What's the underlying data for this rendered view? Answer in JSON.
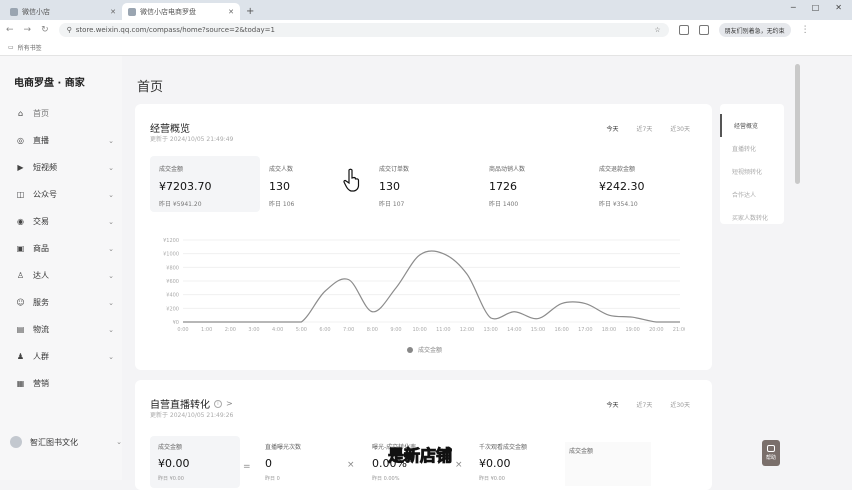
{
  "browser": {
    "tabs": [
      {
        "title": "微信小店"
      },
      {
        "title": "微信小店电商罗盘"
      }
    ],
    "url": "store.weixin.qq.com/compass/home?source=2&today=1",
    "profile": "朋友们别着急，无约束",
    "bookmark": "所有书签"
  },
  "sidebar": {
    "logo": "电商罗盘 · 商家",
    "items": [
      {
        "label": "首页",
        "icon": "home-icon",
        "glyph": "⌂",
        "chev": ""
      },
      {
        "label": "直播",
        "icon": "live-icon",
        "glyph": "◎",
        "chev": "⌄"
      },
      {
        "label": "短视频",
        "icon": "video-icon",
        "glyph": "▶",
        "chev": "⌄"
      },
      {
        "label": "公众号",
        "icon": "official-account-icon",
        "glyph": "◫",
        "chev": "⌄"
      },
      {
        "label": "交易",
        "icon": "trade-icon",
        "glyph": "◉",
        "chev": "⌄"
      },
      {
        "label": "商品",
        "icon": "goods-icon",
        "glyph": "▣",
        "chev": "⌄"
      },
      {
        "label": "达人",
        "icon": "talent-icon",
        "glyph": "♙",
        "chev": "⌄"
      },
      {
        "label": "服务",
        "icon": "service-icon",
        "glyph": "☺",
        "chev": "⌄"
      },
      {
        "label": "物流",
        "icon": "logistics-icon",
        "glyph": "▤",
        "chev": "⌄"
      },
      {
        "label": "人群",
        "icon": "crowd-icon",
        "glyph": "♟",
        "chev": "⌄"
      },
      {
        "label": "营销",
        "icon": "marketing-icon",
        "glyph": "▦",
        "chev": ""
      }
    ],
    "shop_name": "智汇图书文化"
  },
  "page_title": "首页",
  "overview": {
    "title": "经营概览",
    "updated": "更新于 2024/10/05 21:49:49",
    "ranges": [
      "今天",
      "近7天",
      "近30天"
    ],
    "kpis": [
      {
        "label": "成交金额",
        "value": "¥7203.70",
        "prev": "昨日 ¥5941.20"
      },
      {
        "label": "成交人数",
        "value": "130",
        "prev": "昨日 106"
      },
      {
        "label": "成交订单数",
        "value": "130",
        "prev": "昨日 107"
      },
      {
        "label": "商品动销人数",
        "value": "1726",
        "prev": "昨日 1400"
      },
      {
        "label": "成交退款金额",
        "value": "¥242.30",
        "prev": "昨日 ¥354.10"
      }
    ],
    "legend": "成交金额"
  },
  "chart_data": {
    "type": "line",
    "x": [
      "0:00",
      "1:00",
      "2:00",
      "3:00",
      "4:00",
      "5:00",
      "6:00",
      "7:00",
      "8:00",
      "9:00",
      "10:00",
      "11:00",
      "12:00",
      "13:00",
      "14:00",
      "15:00",
      "16:00",
      "17:00",
      "18:00",
      "19:00",
      "20:00",
      "21:00"
    ],
    "y_ticks": [
      "¥0",
      "¥200",
      "¥400",
      "¥600",
      "¥800",
      "¥1000",
      "¥1200"
    ],
    "ylim": [
      0,
      1200
    ],
    "series": [
      {
        "name": "成交金额",
        "values": [
          0,
          0,
          0,
          0,
          0,
          0,
          450,
          620,
          150,
          500,
          980,
          1000,
          700,
          60,
          150,
          50,
          270,
          270,
          100,
          70,
          0,
          0
        ]
      }
    ]
  },
  "subnav": [
    "经营概览",
    "直播转化",
    "短视频转化",
    "合作达人",
    "买家人数转化"
  ],
  "live": {
    "title": "自营直播转化",
    "info": "i",
    "arrow": ">",
    "updated": "更新于 2024/10/05 21:49:26",
    "ranges": [
      "今天",
      "近7天",
      "近30天"
    ],
    "kpis": [
      {
        "label": "成交金额",
        "value": "¥0.00",
        "prev": "昨日 ¥0.00"
      },
      {
        "label": "直播曝光次数",
        "value": "0",
        "prev": "昨日 0"
      },
      {
        "label": "曝光-成交转化率",
        "value": "0.00%",
        "prev": "昨日 0.00%"
      },
      {
        "label": "千次观看成交金额",
        "value": "¥0.00",
        "prev": "昨日 ¥0.00"
      }
    ],
    "ops": [
      "=",
      "×",
      "×"
    ],
    "side_label": "成交金额"
  },
  "overlay_caption": "是新店铺",
  "help_label": "帮助"
}
